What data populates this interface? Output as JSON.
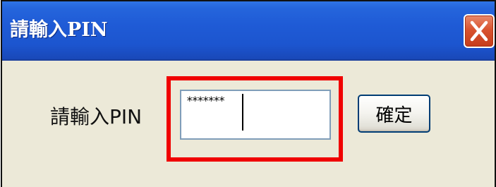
{
  "window": {
    "title": "請輸入PIN",
    "close_icon": "close-icon"
  },
  "form": {
    "pin_label": "請輸入PIN",
    "pin_masked_value": "*******",
    "ok_label": "確定"
  },
  "colors": {
    "titlebar": "#1f5bd6",
    "close_button": "#d9532f",
    "dialog_bg": "#ece9d8",
    "highlight": "#f00000",
    "input_border": "#7f9db9",
    "button_border": "#003c74"
  }
}
